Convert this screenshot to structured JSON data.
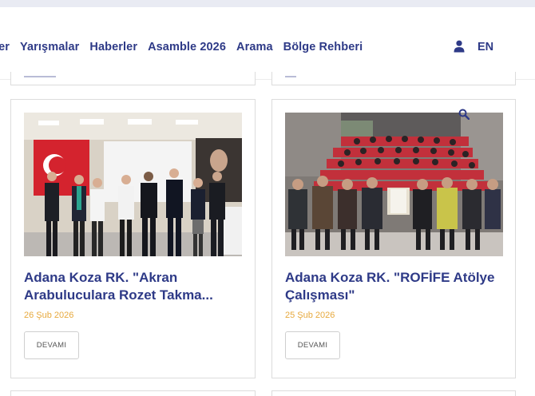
{
  "nav": {
    "items": [
      {
        "label": "ler"
      },
      {
        "label": "Yarışmalar"
      },
      {
        "label": "Haberler"
      },
      {
        "label": "Asamble 2026"
      },
      {
        "label": "Arama"
      },
      {
        "label": "Bölge Rehberi"
      }
    ],
    "user_icon": "user-icon",
    "language": "EN"
  },
  "cards": [
    {
      "title": "Adana Koza RK. \"Akran Arabuluculara Rozet Takma...",
      "date": "26 Şub 2026",
      "button": "DEVAMI"
    },
    {
      "title": "Adana Koza RK. \"ROFİFE Atölye Çalışması\"",
      "date": "25 Şub 2026",
      "button": "DEVAMI"
    }
  ],
  "search_icon": "search-icon",
  "colors": {
    "primary": "#2e3a87",
    "date": "#e7a93d",
    "border": "#dcdcdc"
  }
}
